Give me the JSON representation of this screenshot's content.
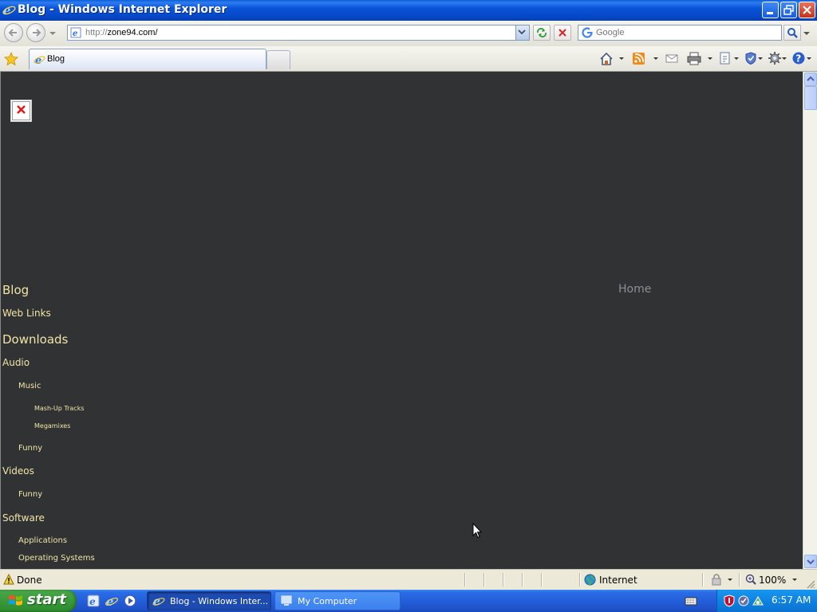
{
  "window": {
    "title": "Blog - Windows Internet Explorer"
  },
  "address_bar": {
    "url_scheme": "http://",
    "url_host": "zone94.com/"
  },
  "search": {
    "placeholder": "Google"
  },
  "tabs": [
    {
      "label": "Blog",
      "active": true
    }
  ],
  "page": {
    "background": "#313234",
    "link_color": "#f1e4a6",
    "home_link": "Home",
    "nav": [
      {
        "label": "Blog"
      },
      {
        "label": "Web Links"
      },
      {
        "label": "Downloads"
      },
      {
        "label": "Audio"
      },
      {
        "label": "Music"
      },
      {
        "label": "Mash-Up Tracks"
      },
      {
        "label": "Megamixes"
      },
      {
        "label": "Funny"
      },
      {
        "label": "Videos"
      },
      {
        "label": "Funny"
      },
      {
        "label": "Software"
      },
      {
        "label": "Applications"
      },
      {
        "label": "Operating Systems"
      }
    ]
  },
  "status_bar": {
    "status": "Done",
    "zone": "Internet",
    "zoom": "100%"
  },
  "taskbar": {
    "start_label": "start",
    "tasks": [
      {
        "label": "Blog - Windows Inter...",
        "active": true
      },
      {
        "label": "My Computer",
        "active": false
      }
    ],
    "clock": "6:57 AM"
  }
}
